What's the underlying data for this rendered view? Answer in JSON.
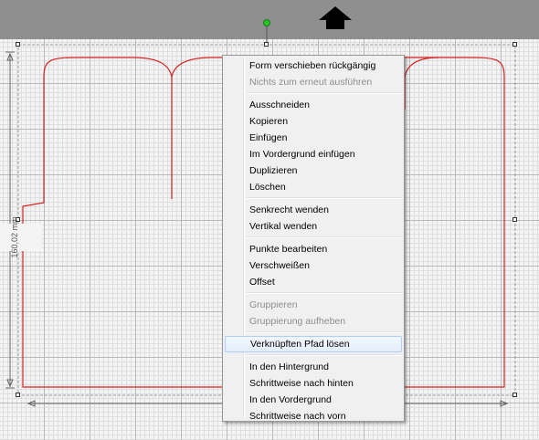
{
  "canvas": {
    "dimension_label": "160,02 mm",
    "path_color": "#d42222",
    "selection_handle_color": "#22c822"
  },
  "context_menu": {
    "groups": [
      [
        {
          "label": "Form verschieben rückgängig",
          "enabled": true
        },
        {
          "label": "Nichts zum erneut ausführen",
          "enabled": false
        }
      ],
      [
        {
          "label": "Ausschneiden",
          "enabled": true
        },
        {
          "label": "Kopieren",
          "enabled": true
        },
        {
          "label": "Einfügen",
          "enabled": true
        },
        {
          "label": "Im Vordergrund einfügen",
          "enabled": true
        },
        {
          "label": "Duplizieren",
          "enabled": true
        },
        {
          "label": "Löschen",
          "enabled": true
        }
      ],
      [
        {
          "label": "Senkrecht wenden",
          "enabled": true
        },
        {
          "label": "Vertikal wenden",
          "enabled": true
        }
      ],
      [
        {
          "label": "Punkte bearbeiten",
          "enabled": true
        },
        {
          "label": "Verschweißen",
          "enabled": true
        },
        {
          "label": "Offset",
          "enabled": true
        }
      ],
      [
        {
          "label": "Gruppieren",
          "enabled": false
        },
        {
          "label": "Gruppierung aufheben",
          "enabled": false
        }
      ],
      [
        {
          "label": "Verknüpften Pfad lösen",
          "enabled": true,
          "highlighted": true
        }
      ],
      [
        {
          "label": "In den Hintergrund",
          "enabled": true
        },
        {
          "label": "Schrittweise nach hinten",
          "enabled": true
        },
        {
          "label": "In den Vordergrund",
          "enabled": true
        },
        {
          "label": "Schrittweise nach vorn",
          "enabled": true
        }
      ]
    ]
  }
}
